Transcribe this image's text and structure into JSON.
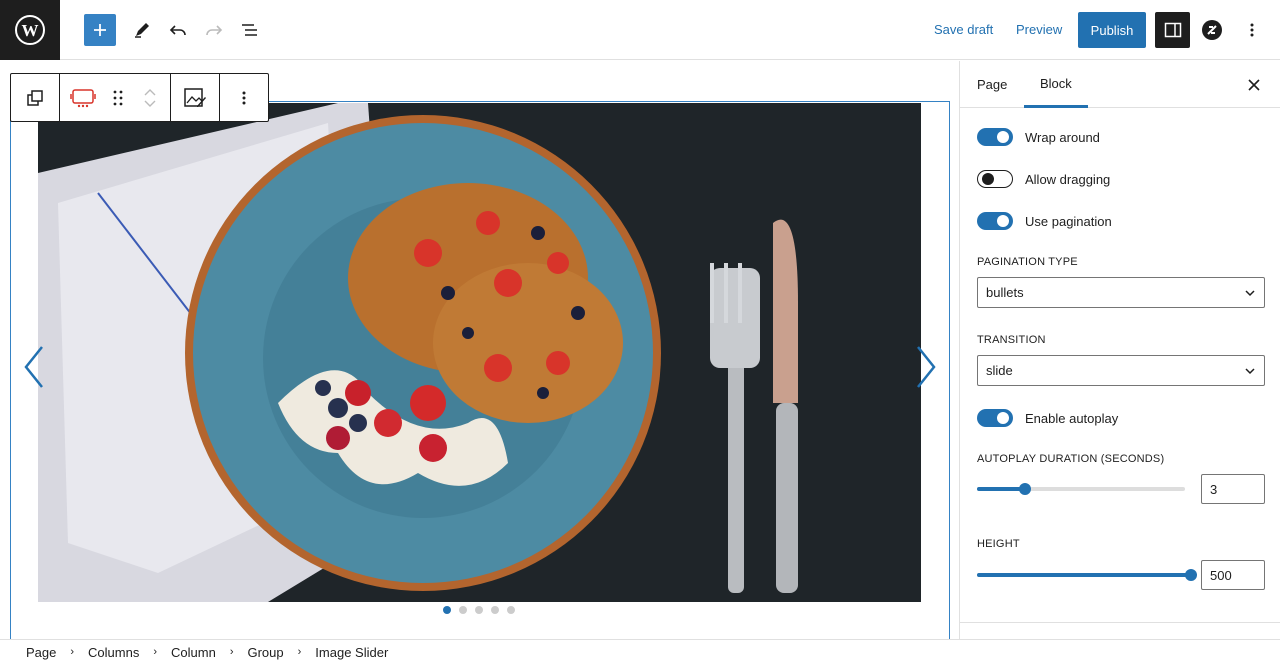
{
  "topbar": {
    "save_draft": "Save draft",
    "preview": "Preview",
    "publish": "Publish"
  },
  "sidebar": {
    "tabs": [
      "Page",
      "Block"
    ],
    "active_tab": "Block",
    "toggles": [
      {
        "label": "Wrap around",
        "on": true
      },
      {
        "label": "Allow dragging",
        "on": false
      },
      {
        "label": "Use pagination",
        "on": true
      },
      {
        "label": "Enable autoplay",
        "on": true
      }
    ],
    "pagination_type": {
      "label": "PAGINATION TYPE",
      "value": "bullets"
    },
    "transition": {
      "label": "TRANSITION",
      "value": "slide"
    },
    "autoplay_duration": {
      "label": "AUTOPLAY DURATION (SECONDS)",
      "value": "3",
      "slider_fraction": 0.23
    },
    "height": {
      "label": "HEIGHT",
      "value": "500",
      "slider_fraction": 1.0
    }
  },
  "slider": {
    "slide_count": 5,
    "active_slide": 1
  },
  "breadcrumb": [
    "Page",
    "Columns",
    "Column",
    "Group",
    "Image Slider"
  ],
  "colors": {
    "accent": "#2271b1",
    "dark": "#1e1e1e"
  }
}
